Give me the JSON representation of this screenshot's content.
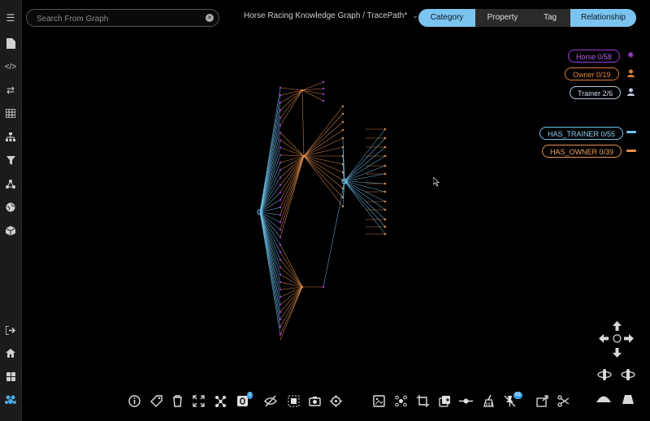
{
  "search": {
    "placeholder": "Search From Graph"
  },
  "header": {
    "title": "Horse Racing Knowledge Graph / TracePath*"
  },
  "tabs": [
    {
      "label": "Category",
      "active": true
    },
    {
      "label": "Property",
      "active": false
    },
    {
      "label": "Tag",
      "active": false
    },
    {
      "label": "Relationship",
      "active": true
    }
  ],
  "legend": {
    "nodes": [
      {
        "label": "Horse 0/58",
        "color": "#a23bd6",
        "icon": "horse-node-icon"
      },
      {
        "label": "Owner 0/19",
        "color": "#e07b2e",
        "icon": "owner-node-icon"
      },
      {
        "label": "Trainer 2/6",
        "color": "#b8c8e0",
        "icon": "trainer-node-icon"
      }
    ],
    "edges": [
      {
        "label": "HAS_TRAINER 0/55",
        "color": "#6fc2ef"
      },
      {
        "label": "HAS_OWNER 0/39",
        "color": "#e89050"
      }
    ]
  },
  "sidebar_icons": [
    "menu-icon",
    "document-icon",
    "code-icon",
    "swap-arrows-icon",
    "table-icon",
    "hierarchy-icon",
    "filter-icon",
    "network-icon",
    "globe-icon",
    "cube-icon",
    "logout-icon",
    "home-icon",
    "grid-icon",
    "community-icon"
  ],
  "toolbar": {
    "icons": [
      "info-icon",
      "tag-icon",
      "trash-icon",
      "expand-icon",
      "share-nodes-icon",
      "outline-count-icon",
      "hide-icon",
      "select-box-icon",
      "camera-icon",
      "focus-target-icon",
      "image-edit-icon",
      "cluster-icon",
      "crop-icon",
      "add-layer-icon",
      "connect-icon",
      "broom-icon",
      "unpin-icon",
      "export-icon",
      "scissor-icon"
    ],
    "badge_layers": "2",
    "badge_pins": "83"
  }
}
